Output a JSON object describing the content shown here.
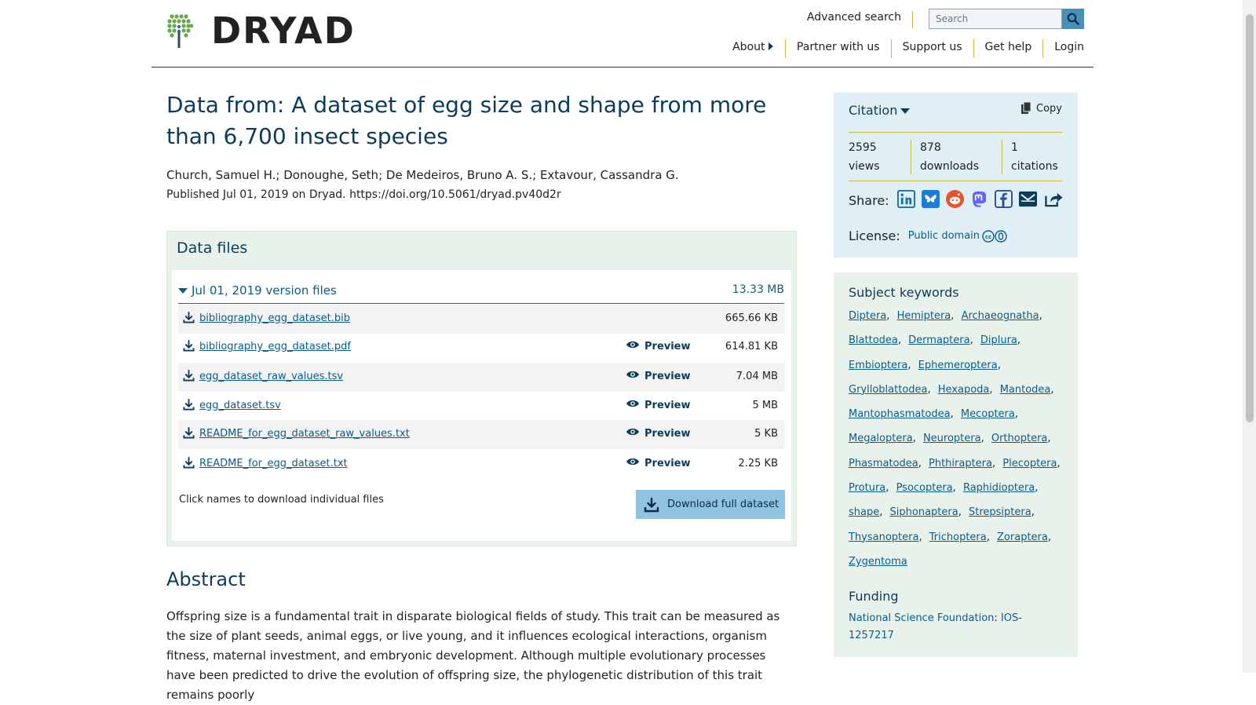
{
  "header": {
    "logo_text": "DRYAD",
    "advanced_search": "Advanced search",
    "search_placeholder": "Search",
    "nav": [
      "About",
      "Partner with us",
      "Support us",
      "Get help",
      "Login"
    ]
  },
  "dataset": {
    "title": "Data from: A dataset of egg size and shape from more than 6,700 insect species",
    "authors": "Church, Samuel H.; Donoughe, Seth; De Medeiros, Bruno A. S.; Extavour, Cassandra G.",
    "published": "Published Jul 01, 2019 on Dryad. https://doi.org/10.5061/dryad.pv40d2r"
  },
  "files": {
    "heading": "Data files",
    "version_label": "Jul 01, 2019 version files",
    "version_size": "13.33 MB",
    "preview_label": "Preview",
    "items": [
      {
        "name": "bibliography_egg_dataset.bib",
        "size": "665.66 KB",
        "preview": false
      },
      {
        "name": "bibliography_egg_dataset.pdf",
        "size": "614.81 KB",
        "preview": true
      },
      {
        "name": "egg_dataset_raw_values.tsv",
        "size": "7.04 MB",
        "preview": true
      },
      {
        "name": "egg_dataset.tsv",
        "size": "5 MB",
        "preview": true
      },
      {
        "name": "README_for_egg_dataset_raw_values.txt",
        "size": "5 KB",
        "preview": true
      },
      {
        "name": "README_for_egg_dataset.txt",
        "size": "2.25 KB",
        "preview": true
      }
    ],
    "hint": "Click names to download individual files",
    "download_full": "Download full dataset"
  },
  "abstract": {
    "heading": "Abstract",
    "text": "Offspring size is a fundamental trait in disparate biological fields of study. This trait can be measured as the size of plant seeds, animal eggs, or live young, and it influences ecological interactions, organism fitness, maternal investment, and embryonic development. Although multiple evolutionary processes have been predicted to drive the evolution of offspring size, the phylogenetic distribution of this trait remains poorly"
  },
  "citation": {
    "heading": "Citation",
    "copy": "Copy",
    "views": "2595",
    "views_label": "views",
    "downloads": "878",
    "downloads_label": "downloads",
    "citations": "1",
    "citations_label": "citations",
    "share_label": "Share:",
    "share_icons": [
      "linkedin-icon",
      "bluesky-icon",
      "reddit-icon",
      "mastodon-icon",
      "facebook-icon",
      "email-icon",
      "share-icon"
    ],
    "license_label": "License:",
    "license_value": "Public domain"
  },
  "keywords": {
    "heading": "Subject keywords",
    "items": [
      "Diptera",
      "Hemiptera",
      "Archaeognatha",
      "Blattodea",
      "Dermaptera",
      "Diplura",
      "Embioptera",
      "Ephemeroptera",
      "Grylloblattodea",
      "Hexapoda",
      "Mantodea",
      "Mantophasmatodea",
      "Mecoptera",
      "Megaloptera",
      "Neuroptera",
      "Orthoptera",
      "Phasmatodea",
      "Phthiraptera",
      "Plecoptera",
      "Protura",
      "Psocoptera",
      "Raphidioptera",
      "shape",
      "Siphonaptera",
      "Strepsiptera",
      "Thysanoptera",
      "Trichoptera",
      "Zoraptera",
      "Zygentoma"
    ]
  },
  "funding": {
    "heading": "Funding",
    "funder": "National Science Foundation",
    "award": "IOS-1257217"
  }
}
